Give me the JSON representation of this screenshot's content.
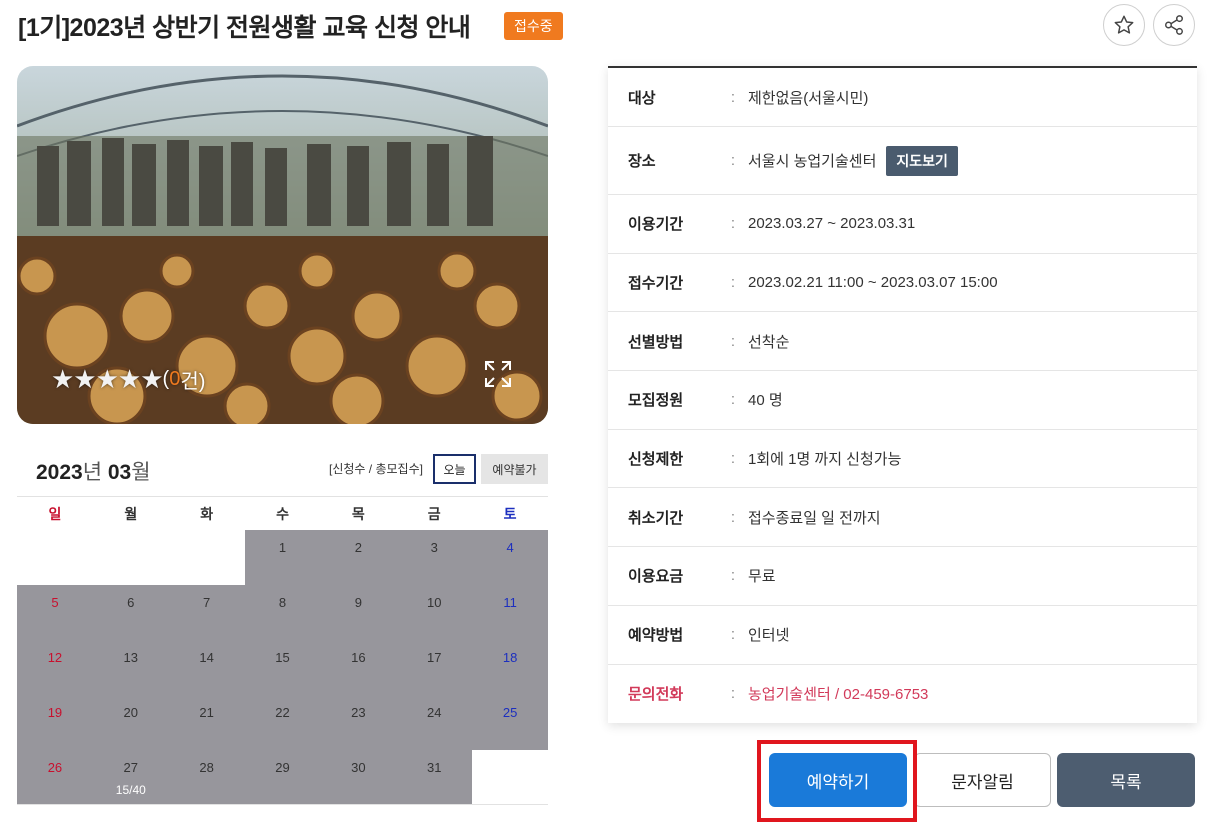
{
  "header": {
    "title": "[1기]2023년 상반기 전원생활 교육 신청 안내",
    "status_badge": "접수중",
    "favorite_icon": "star-outline-icon",
    "share_icon": "share-icon"
  },
  "photo": {
    "rating_stars": "★★★★★",
    "rating_open": "(",
    "rating_count": "0",
    "rating_close": " 건)",
    "expand_icon": "expand-icon"
  },
  "calendar": {
    "year": "2023",
    "year_unit": "년 ",
    "month": "03",
    "month_unit": "월",
    "legend": "[신청수 / 총모집수]",
    "today_label": "오늘",
    "unavailable_label": "예약불가",
    "weekdays": [
      "일",
      "월",
      "화",
      "수",
      "목",
      "금",
      "토"
    ],
    "weeks": [
      [
        "",
        "",
        "",
        "1",
        "2",
        "3",
        "4"
      ],
      [
        "5",
        "6",
        "7",
        "8",
        "9",
        "10",
        "11"
      ],
      [
        "12",
        "13",
        "14",
        "15",
        "16",
        "17",
        "18"
      ],
      [
        "19",
        "20",
        "21",
        "22",
        "23",
        "24",
        "25"
      ],
      [
        "26",
        "27",
        "28",
        "29",
        "30",
        "31",
        ""
      ]
    ],
    "apply_counts": {
      "27": "15/40"
    }
  },
  "info": [
    {
      "label": "대상",
      "value": "제한없음(서울시민)"
    },
    {
      "label": "장소",
      "value": "서울시 농업기술센터",
      "button": "지도보기"
    },
    {
      "label": "이용기간",
      "value": "2023.03.27 ~ 2023.03.31"
    },
    {
      "label": "접수기간",
      "value": "2023.02.21 11:00 ~ 2023.03.07 15:00"
    },
    {
      "label": "선별방법",
      "value": "선착순"
    },
    {
      "label": "모집정원",
      "value": "40 명"
    },
    {
      "label": "신청제한",
      "value": "1회에 1명 까지 신청가능"
    },
    {
      "label": "취소기간",
      "value": "접수종료일 일 전까지"
    },
    {
      "label": "이용요금",
      "value": "무료"
    },
    {
      "label": "예약방법",
      "value": "인터넷"
    },
    {
      "label": "문의전화",
      "value": "농업기술센터 / 02-459-6753"
    }
  ],
  "separator": ":",
  "actions": {
    "reserve": "예약하기",
    "sms": "문자알림",
    "list": "목록"
  },
  "colors": {
    "badge": "#f07a1f",
    "primary": "#1a7ad9",
    "dark_button": "#4d5d70",
    "closed_day": "#97969c",
    "highlight": "#e0161e",
    "phone": "#d23a5a"
  }
}
